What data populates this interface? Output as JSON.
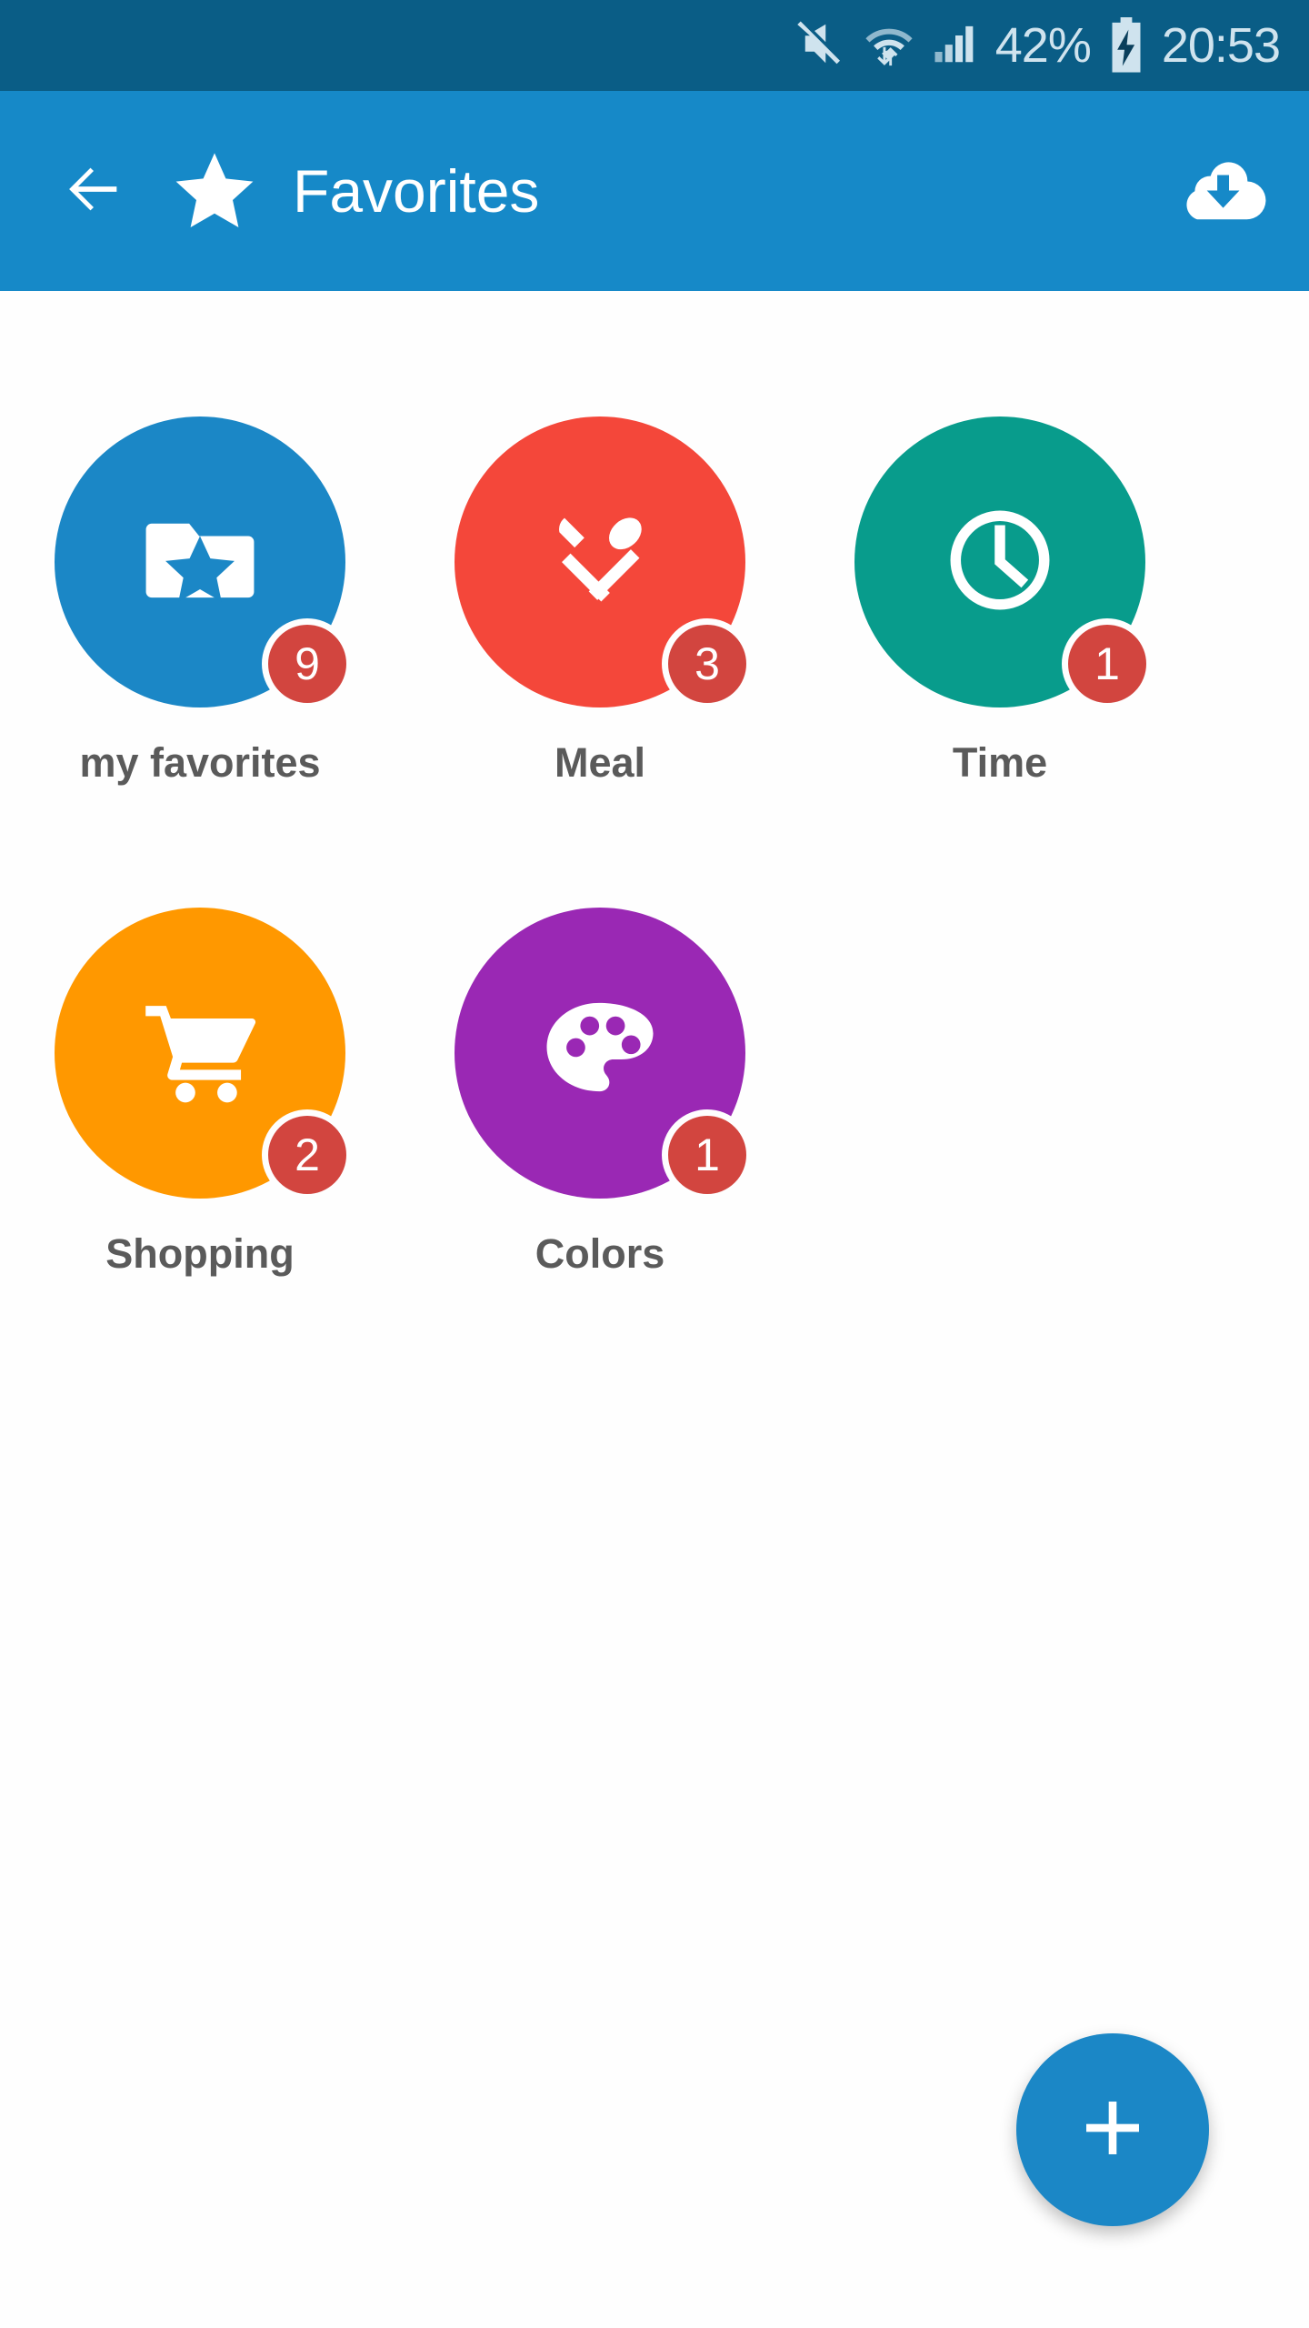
{
  "status_bar": {
    "icons": [
      "mute-icon",
      "wifi-icon",
      "signal-icon"
    ],
    "battery_percent": "42%",
    "battery_state": "charging",
    "time": "20:53",
    "background": "#0a5d86",
    "foreground": "#cfe3ee"
  },
  "app_bar": {
    "back_label": "back-arrow",
    "brand_icon": "star-icon",
    "title": "Favorites",
    "action_icon": "cloud-download-icon",
    "background": "#1689c8"
  },
  "grid": {
    "tiles": [
      {
        "label": "my favorites",
        "icon": "folder-star-icon",
        "badge": "9",
        "color": "#1b87c6"
      },
      {
        "label": "Meal",
        "icon": "cutlery-icon",
        "badge": "3",
        "color": "#f4473a"
      },
      {
        "label": "Time",
        "icon": "clock-icon",
        "badge": "1",
        "color": "#089c8c"
      },
      {
        "label": "Shopping",
        "icon": "shopping-cart-icon",
        "badge": "2",
        "color": "#ff9800"
      },
      {
        "label": "Colors",
        "icon": "palette-icon",
        "badge": "1",
        "color": "#9a28b4"
      }
    ],
    "badge_color": "#d2453f",
    "label_color": "#5a5a5a"
  },
  "fab": {
    "icon": "plus-icon",
    "label": "add",
    "color": "#1b87c6"
  }
}
